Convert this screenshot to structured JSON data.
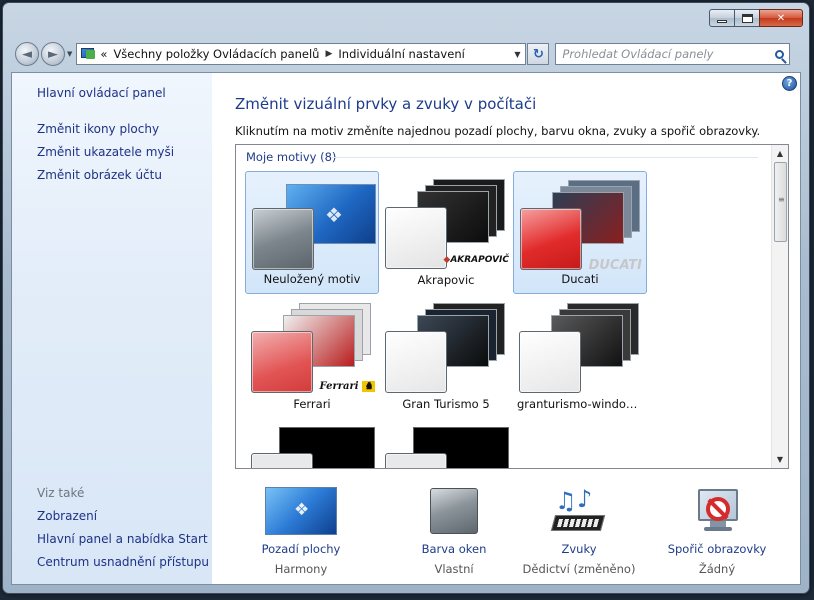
{
  "window": {
    "caption_min": "",
    "caption_max": "",
    "caption_close": "✕"
  },
  "nav": {
    "back_icon": "back-arrow-icon",
    "forward_icon": "forward-arrow-icon",
    "breadcrumbs": [
      "Všechny položky Ovládacích panelů",
      "Individuální nastavení"
    ],
    "breadcrumb_prefix": "«",
    "search_placeholder": "Prohledat Ovládací panely"
  },
  "sidebar": {
    "home": "Hlavní ovládací panel",
    "tasks": [
      "Změnit ikony plochy",
      "Změnit ukazatele myši",
      "Změnit obrázek účtu"
    ],
    "see_also_title": "Viz také",
    "see_also": [
      "Zobrazení",
      "Hlavní panel a nabídka Start",
      "Centrum usnadnění přístupu"
    ]
  },
  "main": {
    "title": "Změnit vizuální prvky a zvuky v počítači",
    "description": "Kliknutím na motiv změníte najednou pozadí plochy, barvu okna, zvuky a spořič obrazovky.",
    "group_header": "Moje motivy (8)",
    "themes": [
      {
        "label": "Neuložený motiv",
        "selected": true,
        "swatch": "#8e969c",
        "bg": "#2f72c9",
        "brand": ""
      },
      {
        "label": "Akrapovic",
        "selected": false,
        "swatch": "#e9e9e9",
        "bg": "#141414",
        "brand": "AKRAPOVIČ"
      },
      {
        "label": "Ducati",
        "selected": true,
        "swatch": "#e33a3a",
        "bg": "#2a3c55",
        "brand": "DUCATI"
      },
      {
        "label": "Ferrari",
        "selected": false,
        "swatch": "#e06a6a",
        "bg": "#eaeaea",
        "brand": "Ferrari"
      },
      {
        "label": "Gran Turismo 5",
        "selected": false,
        "swatch": "#f2f2f2",
        "bg": "#101010",
        "brand": ""
      },
      {
        "label": "granturismo-window...",
        "selected": false,
        "swatch": "#f2f2f2",
        "bg": "#1a1a1a",
        "brand": ""
      }
    ]
  },
  "bottom": [
    {
      "label": "Pozadí plochy",
      "value": "Harmony",
      "icon": "desktop-background-icon"
    },
    {
      "label": "Barva oken",
      "value": "Vlastní",
      "icon": "window-color-icon"
    },
    {
      "label": "Zvuky",
      "value": "Dědictví (změněno)",
      "icon": "sounds-icon"
    },
    {
      "label": "Spořič obrazovky",
      "value": "Žádný",
      "icon": "screensaver-icon"
    }
  ],
  "colors": {
    "link": "#1e3287",
    "title": "#1e3c8c",
    "selection_border": "#84acdd"
  }
}
